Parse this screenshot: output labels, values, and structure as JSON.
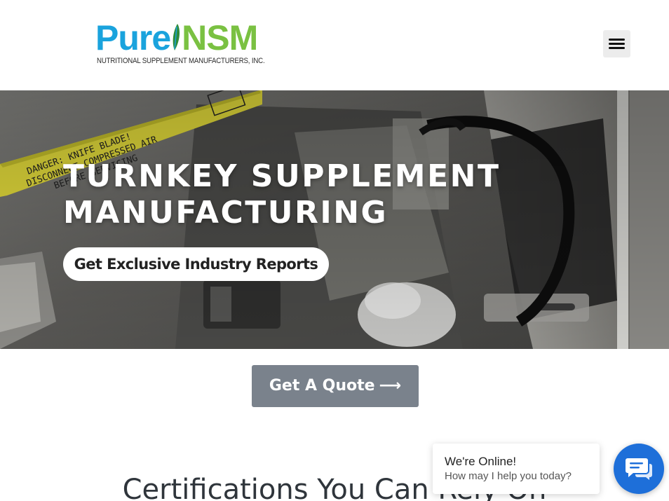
{
  "header": {
    "logo": {
      "word_left": "Pure",
      "word_right": "NSM",
      "subtitle": "NUTRITIONAL SUPPLEMENT MANUFACTURERS, INC."
    },
    "menu_icon": "hamburger-icon"
  },
  "hero": {
    "title_line1": "TURNKEY SUPPLEMENT",
    "title_line2": "MANUFACTURING",
    "pill_label": "Get Exclusive Industry Reports",
    "warning_label_text": "DANGER: KNIFE BLADE! DISCONNECT COMPRESSED AIR BEFORE SERVICING"
  },
  "cta": {
    "quote_label": "Get A Quote",
    "quote_arrow": "⟶"
  },
  "certifications": {
    "heading": "Certifications You Can Rely On"
  },
  "chat": {
    "status": "We're Online!",
    "prompt": "How may I help you today?",
    "launcher_icon": "chat-icon"
  },
  "colors": {
    "brand_blue": "#1aa3dd",
    "brand_green": "#7ac142",
    "quote_button": "#7a828c",
    "chat_blue": "#1e6fd9"
  }
}
